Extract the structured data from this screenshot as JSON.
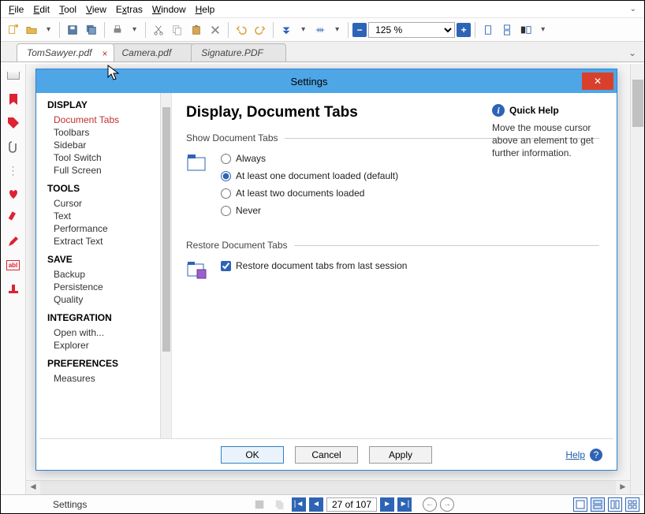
{
  "menu": {
    "file": "File",
    "edit": "Edit",
    "tool": "Tool",
    "view": "View",
    "extras": "Extras",
    "window": "Window",
    "help": "Help"
  },
  "toolbar": {
    "zoom": "125 %"
  },
  "tabs": {
    "t1": "TomSawyer.pdf",
    "t2": "Camera.pdf",
    "t3": "Signature.PDF"
  },
  "status": {
    "label": "Settings",
    "page": "27 of 107"
  },
  "dialog": {
    "title": "Settings",
    "heading": "Display, Document Tabs",
    "section1": "Show Document Tabs",
    "r1": "Always",
    "r2": "At least one document loaded (default)",
    "r3": "At least two documents loaded",
    "r4": "Never",
    "section2": "Restore Document Tabs",
    "c1": "Restore document tabs from last session",
    "ok": "OK",
    "cancel": "Cancel",
    "apply": "Apply",
    "help": "Help",
    "qh_title": "Quick Help",
    "qh_text": "Move the mouse cursor above an element to get further information.",
    "tree": {
      "g1": "DISPLAY",
      "g1a": "Document Tabs",
      "g1b": "Toolbars",
      "g1c": "Sidebar",
      "g1d": "Tool Switch",
      "g1e": "Full Screen",
      "g2": "TOOLS",
      "g2a": "Cursor",
      "g2b": "Text",
      "g2c": "Performance",
      "g2d": "Extract Text",
      "g3": "SAVE",
      "g3a": "Backup",
      "g3b": "Persistence",
      "g3c": "Quality",
      "g4": "INTEGRATION",
      "g4a": "Open with...",
      "g4b": "Explorer",
      "g5": "PREFERENCES",
      "g5a": "Measures"
    }
  }
}
